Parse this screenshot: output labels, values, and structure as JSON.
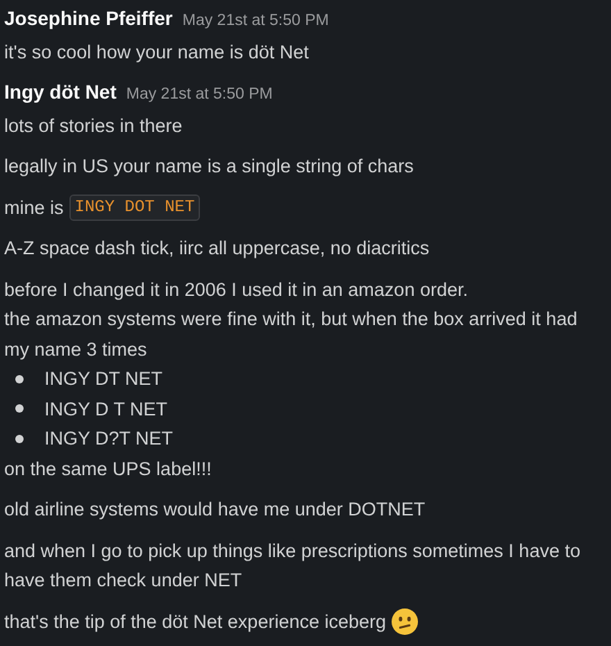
{
  "messages": [
    {
      "author": "Josephine Pfeiffer",
      "time": "May 21st at 5:50 PM",
      "blocks": [
        {
          "lines": [
            {
              "kind": "text",
              "text": "it's so cool how your name is döt Net"
            }
          ]
        }
      ]
    },
    {
      "author": "Ingy döt Net",
      "time": "May 21st at 5:50 PM",
      "blocks": [
        {
          "lines": [
            {
              "kind": "text",
              "text": "lots of stories in there"
            }
          ]
        },
        {
          "lines": [
            {
              "kind": "text",
              "text": "legally in US your name is a single string of chars"
            }
          ]
        },
        {
          "lines": [
            {
              "kind": "code",
              "text": "mine is",
              "code": "INGY DOT NET"
            }
          ]
        },
        {
          "lines": [
            {
              "kind": "text",
              "text": "A-Z space dash tick, iirc all uppercase, no diacritics"
            }
          ]
        },
        {
          "lines": [
            {
              "kind": "text",
              "text": "before I changed it in 2006 I used it in an amazon order."
            },
            {
              "kind": "text",
              "text": "the amazon systems were fine with it, but when the box arrived it had my name 3 times"
            },
            {
              "kind": "bullet",
              "text": "INGY DT NET"
            },
            {
              "kind": "bullet",
              "text": "INGY D T NET"
            },
            {
              "kind": "bullet",
              "text": "INGY D?T NET"
            },
            {
              "kind": "text",
              "text": "on the same UPS label!!!"
            }
          ]
        },
        {
          "lines": [
            {
              "kind": "text",
              "text": "old airline systems would have me under DOTNET"
            }
          ]
        },
        {
          "lines": [
            {
              "kind": "text",
              "text": "and when I go to pick up things like prescriptions sometimes I have to have them check under NET"
            }
          ]
        },
        {
          "lines": [
            {
              "kind": "emoji",
              "text": "that's the tip of the döt Net experience iceberg"
            }
          ]
        }
      ]
    }
  ]
}
